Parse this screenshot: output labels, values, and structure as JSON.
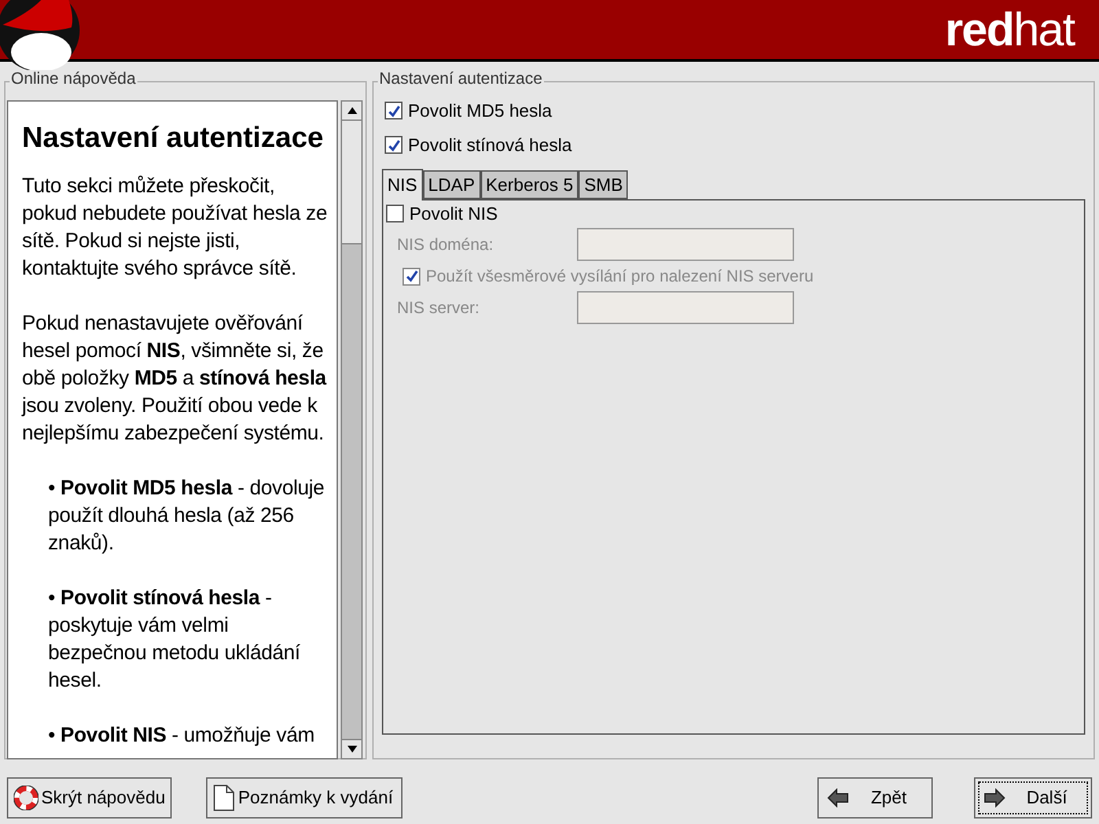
{
  "header": {
    "logo_text": "**red**hat"
  },
  "help": {
    "title": "Online nápověda",
    "blocks": [
      {
        "kind": "heading",
        "text": "Nastavení autentizace"
      },
      {
        "kind": "paragraph",
        "text": "Tuto sekci můžete přeskočit, pokud nebudete používat hesla ze sítě. Pokud si nejste jisti, kontaktujte svého správce sítě."
      },
      {
        "kind": "paragraph",
        "text": "Pokud nenastavujete ověřování hesel pomocí **NIS**, všimněte si, že obě položky **MD5** a **stínová hesla** jsou zvoleny. Použití obou vede k nejlepšímu zabezpečení systému."
      },
      {
        "kind": "bullet",
        "text": "• **Povolit MD5 hesla** - dovoluje použít dlouhá hesla (až 256 znaků)."
      },
      {
        "kind": "bullet",
        "text": "• **Povolit stínová hesla** - poskytuje vám velmi bezpečnou metodu ukládání hesel."
      },
      {
        "kind": "bullet",
        "text": "• **Povolit NIS** - umožňuje vám"
      }
    ]
  },
  "auth": {
    "title": "Nastavení autentizace",
    "checkboxes": [
      {
        "label": "Povolit MD5 hesla",
        "checked": true
      },
      {
        "label": "Povolit stínová hesla",
        "checked": true
      }
    ],
    "tabs": [
      {
        "label": "NIS",
        "selected": true
      },
      {
        "label": "LDAP",
        "selected": false
      },
      {
        "label": "Kerberos 5",
        "selected": false
      },
      {
        "label": "SMB",
        "selected": false
      }
    ],
    "nis": {
      "enable": {
        "label": "Povolit NIS",
        "checked": false
      },
      "rows": [
        {
          "kind": "field",
          "label": "NIS doména:",
          "disabled": true
        },
        {
          "kind": "checkbox",
          "label": "Použít všesměrové vysílání pro nalezení NIS serveru",
          "checked": true,
          "disabled": true
        },
        {
          "kind": "field",
          "label": "NIS server:",
          "disabled": true
        }
      ]
    }
  },
  "buttons": [
    {
      "label": "Skrýt nápovědu",
      "kind": "lifebuoy",
      "focused": false
    },
    {
      "label": "Poznámky k vydání",
      "kind": "page",
      "focused": false
    },
    {
      "label": "Zpět",
      "kind": "back",
      "focused": false
    },
    {
      "label": "Další",
      "kind": "next",
      "focused": true
    }
  ]
}
